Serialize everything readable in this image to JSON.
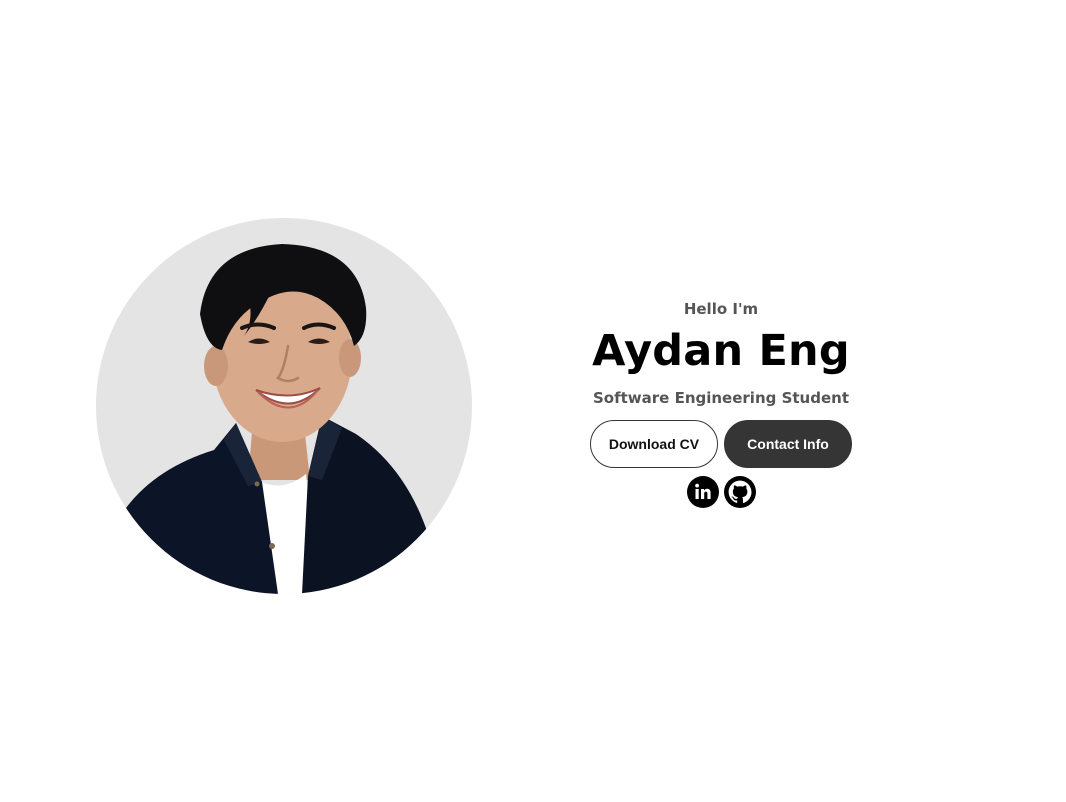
{
  "hero": {
    "greeting": "Hello I'm",
    "name": "Aydan Eng",
    "role": "Software Engineering Student",
    "download_cv_label": "Download CV",
    "contact_info_label": "Contact Info"
  },
  "profile": {
    "photo_alt": "Aydan Eng profile picture"
  },
  "socials": [
    {
      "icon": "linkedin-icon",
      "alt": "My LinkedIn profile"
    },
    {
      "icon": "github-icon",
      "alt": "My Github profile"
    }
  ],
  "colors": {
    "background": "#ffffff",
    "photo_backdrop": "#e4e4e4",
    "button_dark": "#353535",
    "text_muted": "#555555",
    "text_primary": "#000000"
  }
}
